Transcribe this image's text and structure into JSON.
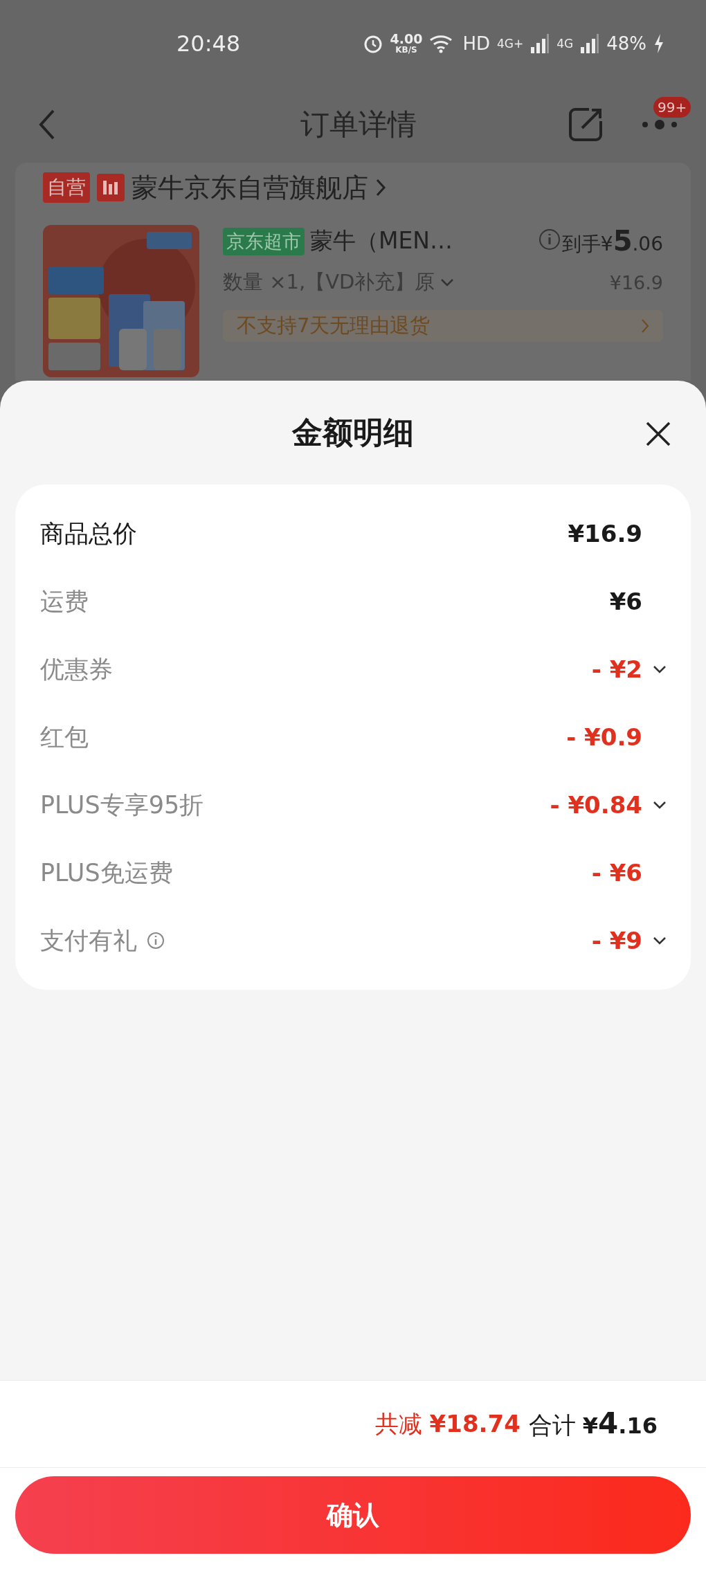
{
  "status_bar": {
    "time": "20:48",
    "net_speed": "4.00",
    "net_speed_unit": "KB/S",
    "hd": "HD",
    "sim1": "4G+",
    "sim2": "4G",
    "battery": "48%"
  },
  "header": {
    "title": "订单详情",
    "badge": "99+"
  },
  "store": {
    "tag": "自营",
    "name": "蒙牛京东自营旗舰店"
  },
  "product": {
    "tag": "京东超市",
    "name": "蒙牛（MEN…",
    "price_label": "到手",
    "price_symbol": "¥",
    "price_main": "5",
    "price_fraction": ".06",
    "spec": "数量 ×1,【VD补充】原",
    "original_price": "¥16.9",
    "notice": "不支持7天无理由退货"
  },
  "sheet": {
    "title": "金额明细",
    "rows": [
      {
        "label": "商品总价",
        "value": "¥16.9",
        "kind": "total",
        "expandable": false,
        "info": false
      },
      {
        "label": "运费",
        "value": "¥6",
        "kind": "fee",
        "expandable": false,
        "info": false
      },
      {
        "label": "优惠券",
        "value": "- ¥2",
        "kind": "discount",
        "expandable": true,
        "info": false
      },
      {
        "label": "红包",
        "value": "- ¥0.9",
        "kind": "discount",
        "expandable": false,
        "info": false
      },
      {
        "label": "PLUS专享95折",
        "value": "- ¥0.84",
        "kind": "discount",
        "expandable": true,
        "info": false
      },
      {
        "label": "PLUS免运费",
        "value": "- ¥6",
        "kind": "discount",
        "expandable": false,
        "info": false
      },
      {
        "label": "支付有礼",
        "value": "- ¥9",
        "kind": "discount",
        "expandable": true,
        "info": true
      }
    ]
  },
  "summary": {
    "saved_label": "共减",
    "saved_value": "¥18.74",
    "total_label": "合计",
    "total_symbol": "¥",
    "total_main": "4",
    "total_fraction": ".16"
  },
  "confirm": "确认"
}
